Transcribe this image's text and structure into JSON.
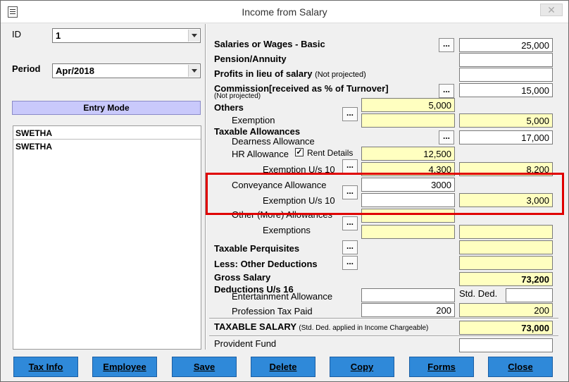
{
  "window": {
    "title": "Income from Salary",
    "close_label": "✕"
  },
  "left": {
    "id_label": "ID",
    "id_value": "1",
    "period_label": "Period",
    "period_value": "Apr/2018",
    "entry_mode_label": "Entry Mode",
    "list_header": "SWETHA",
    "list_items": [
      "SWETHA"
    ]
  },
  "salary": {
    "basic_label": "Salaries or Wages - Basic",
    "basic_value": "25,000",
    "pension_label": "Pension/Annuity",
    "pension_value": "",
    "profits_label": "Profits in lieu of salary",
    "profits_note": "(Not projected)",
    "profits_value": "",
    "commission_label": "Commission[received as % of Turnover]",
    "commission_note": "(Not projected)",
    "commission_value": "15,000",
    "others_label": "Others",
    "others_value": "5,000",
    "exemption_label": "Exemption",
    "exemption_left": "",
    "exemption_right": "5,000"
  },
  "allowances": {
    "heading": "Taxable Allowances",
    "dearness_label": "Dearness Allowance",
    "dearness_value": "17,000",
    "hra_label": "HR Allowance",
    "rent_details_label": "Rent Details",
    "rent_details_checked": true,
    "hra_value": "12,500",
    "hra_exemption_label": "Exemption U/s 10",
    "hra_exemption_left": "4,300",
    "hra_exemption_right": "8,200",
    "conveyance_label": "Conveyance Allowance",
    "conveyance_value": "3000",
    "conveyance_exemption_label": "Exemption U/s 10",
    "conveyance_exemption_left": "",
    "conveyance_exemption_right": "3,000",
    "other_label": "Other (More) Allowances",
    "other_value": "",
    "other_exemptions_label": "Exemptions",
    "other_exemptions_left": "",
    "other_exemptions_right": ""
  },
  "perquisites": {
    "label": "Taxable Perquisites",
    "value": "",
    "other_deductions_label": "Less: Other Deductions",
    "other_deductions_value": ""
  },
  "gross": {
    "label": "Gross Salary",
    "value": "73,200"
  },
  "deductions": {
    "heading": "Deductions U/s 16",
    "entertainment_label": "Entertainment Allowance",
    "entertainment_value": "",
    "std_ded_label": "Std. Ded.",
    "std_ded_value": "",
    "profession_tax_label": "Profession Tax Paid",
    "profession_tax_left": "200",
    "profession_tax_right": "200"
  },
  "taxable": {
    "label": "TAXABLE SALARY",
    "note": "(Std. Ded. applied in Income Chargeable)",
    "value": "73,000"
  },
  "provident": {
    "label": "Provident Fund",
    "value": ""
  },
  "dots_label": "...",
  "buttons": {
    "tax_info": "Tax Info",
    "employee": "Employee",
    "save": "Save",
    "delete": "Delete",
    "copy": "Copy",
    "forms": "Forms",
    "close": "Close"
  },
  "colors": {
    "button_bg": "#2f89d9",
    "input_yellow": "#ffffc0",
    "entry_mode_bg": "#c9c9fb",
    "highlight": "#e00000"
  }
}
